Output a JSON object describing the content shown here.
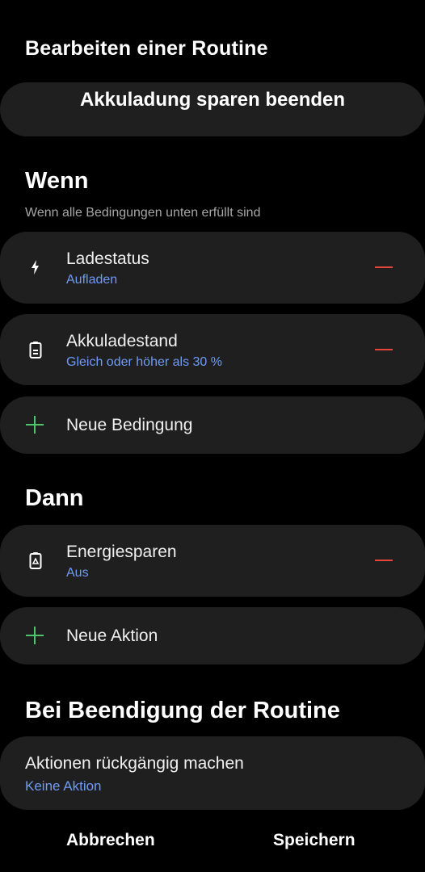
{
  "header": {
    "title": "Bearbeiten einer Routine"
  },
  "routine": {
    "name": "Akkuladung sparen beenden"
  },
  "if_section": {
    "title": "Wenn",
    "subtitle": "Wenn alle Bedingungen unten erfüllt sind",
    "conditions": [
      {
        "title": "Ladestatus",
        "value": "Aufladen",
        "icon": "bolt-icon"
      },
      {
        "title": "Akkuladestand",
        "value": "Gleich oder höher als 30 %",
        "icon": "battery-icon"
      }
    ],
    "add_label": "Neue Bedingung"
  },
  "then_section": {
    "title": "Dann",
    "actions": [
      {
        "title": "Energiesparen",
        "value": "Aus",
        "icon": "battery-saver-icon"
      }
    ],
    "add_label": "Neue Aktion"
  },
  "end_section": {
    "title": "Bei Beendigung der Routine",
    "item_title": "Aktionen rückgängig machen",
    "item_value": "Keine Aktion"
  },
  "footer": {
    "cancel": "Abbrechen",
    "save": "Speichern"
  },
  "colors": {
    "accent_blue": "#6f9bf5",
    "remove_red": "#e5453a",
    "add_green": "#4fc46a",
    "card_bg": "#1f1f1f"
  }
}
